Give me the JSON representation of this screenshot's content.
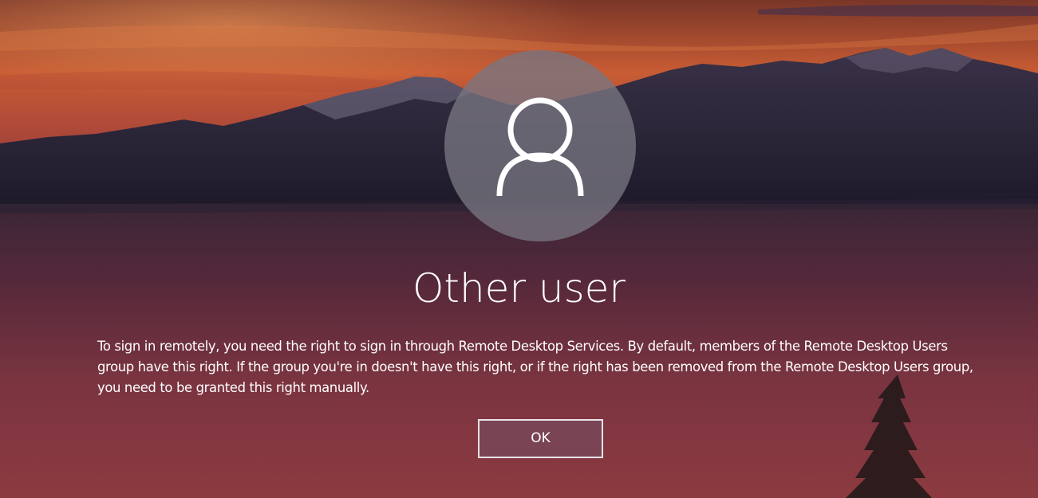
{
  "screen": {
    "type": "windows-sign-in-error",
    "avatar_icon": "user-silhouette-icon"
  },
  "user": {
    "name": "Other user"
  },
  "message": {
    "text": "To sign in remotely, you need the right to sign in through Remote Desktop Services. By default, members of the Remote Desktop Users group have this right. If the group you're in doesn't have this right, or if the right has been removed from the Remote Desktop Users group, you need to be granted this right manually."
  },
  "actions": {
    "ok_label": "OK"
  },
  "colors": {
    "sky_top": "#8a3a2a",
    "sky_glow": "#d96a3a",
    "mountains": "#2a2438",
    "lake": "#5e2a3c",
    "text": "#ffffff"
  }
}
